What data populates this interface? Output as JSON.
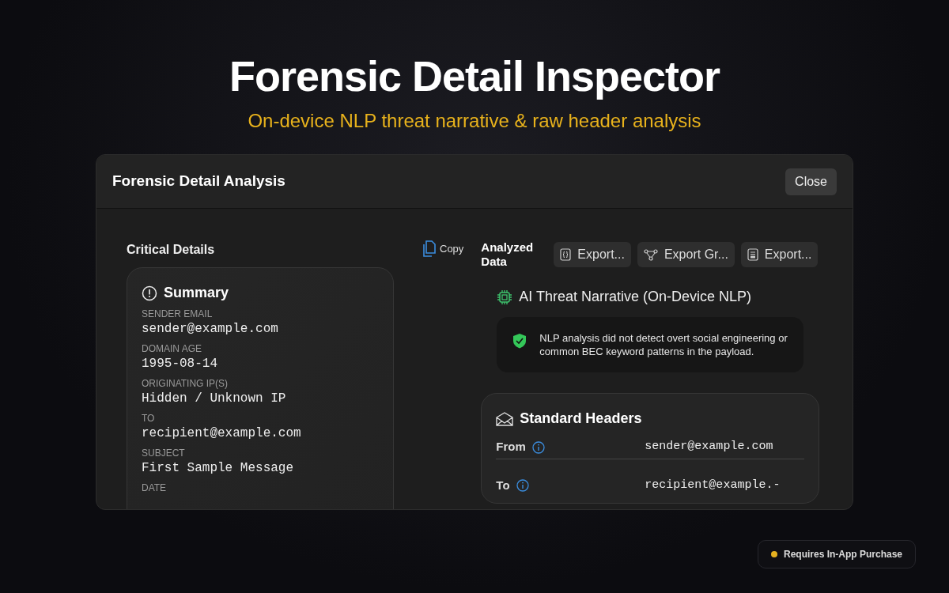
{
  "hero": {
    "title": "Forensic Detail Inspector",
    "subtitle": "On-device NLP threat narrative & raw header analysis"
  },
  "window": {
    "title": "Forensic Detail Analysis",
    "close_button": "Close"
  },
  "critical_details": {
    "heading": "Critical Details",
    "summary": {
      "title": "Summary",
      "fields": [
        {
          "label": "SENDER EMAIL",
          "value": "sender@example.com"
        },
        {
          "label": "DOMAIN AGE",
          "value": "1995-08-14"
        },
        {
          "label": "ORIGINATING IP(S)",
          "value": "Hidden / Unknown IP"
        },
        {
          "label": "TO",
          "value": "recipient@example.com"
        },
        {
          "label": "SUBJECT",
          "value": "First Sample Message"
        },
        {
          "label": "DATE"
        }
      ]
    }
  },
  "copy_button": "Copy",
  "analyzed_data": {
    "heading": "Analyzed Data",
    "export_buttons": [
      "Export...",
      "Export Gr...",
      "Export..."
    ],
    "threat_narrative": {
      "title": "AI Threat Narrative (On-Device NLP)",
      "message": "NLP analysis did not detect overt social engineering or common BEC keyword patterns in the payload."
    },
    "standard_headers": {
      "title": "Standard Headers",
      "rows": [
        {
          "label": "From",
          "value": "sender@example.com"
        },
        {
          "label": "To",
          "value": "recipient@example.-"
        }
      ]
    }
  },
  "badge": {
    "text": "Requires In-App Purchase",
    "color": "#e5b120"
  }
}
